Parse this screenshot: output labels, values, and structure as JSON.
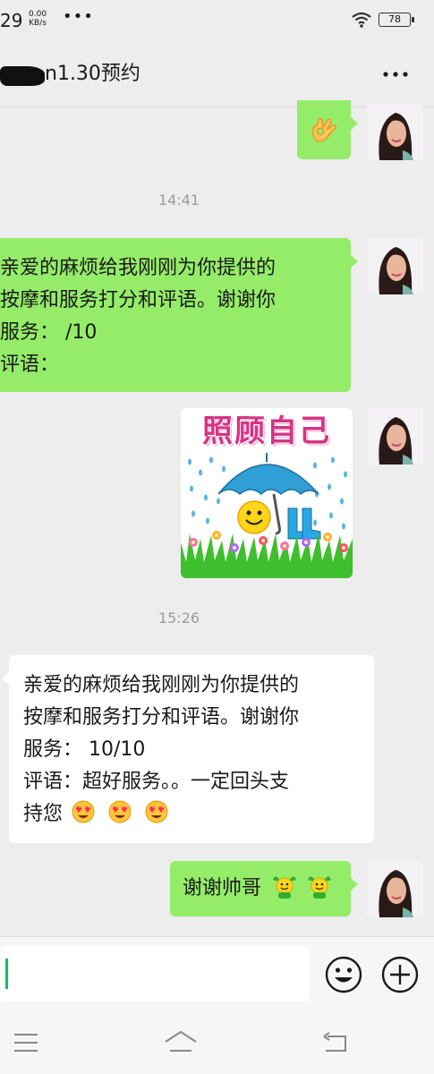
{
  "status_bar": {
    "time": "29",
    "net_speed_value": "0.00",
    "net_speed_unit": "KB/s",
    "dots": "•••",
    "battery": "78"
  },
  "header": {
    "title": "n1.30预约",
    "more_icon": "more-icon"
  },
  "messages": {
    "ok_sticker": "ok-hand-emoji",
    "time_1": "14:41",
    "request_1": {
      "line_1": "亲爱的麻烦给我刚刚为你提供的",
      "line_2": "按摩和服务打分和评语。谢谢你",
      "line_3": "服务：  /10",
      "line_4": "评语："
    },
    "sticker_title": "照顾自己",
    "time_2": "15:26",
    "reply": {
      "line_1": "亲爱的麻烦给我刚刚为你提供的",
      "line_2": "按摩和服务打分和评语。谢谢你",
      "line_3": "服务：  10/10",
      "line_4": "评语：超好服务。。一定回头支",
      "line_5": "持您"
    },
    "thanks": "谢谢帅哥"
  },
  "input_bar": {
    "placeholder": "",
    "value": ""
  },
  "colors": {
    "bubble_green": "#95ec69",
    "background": "#ededed",
    "cursor": "#07c160"
  }
}
